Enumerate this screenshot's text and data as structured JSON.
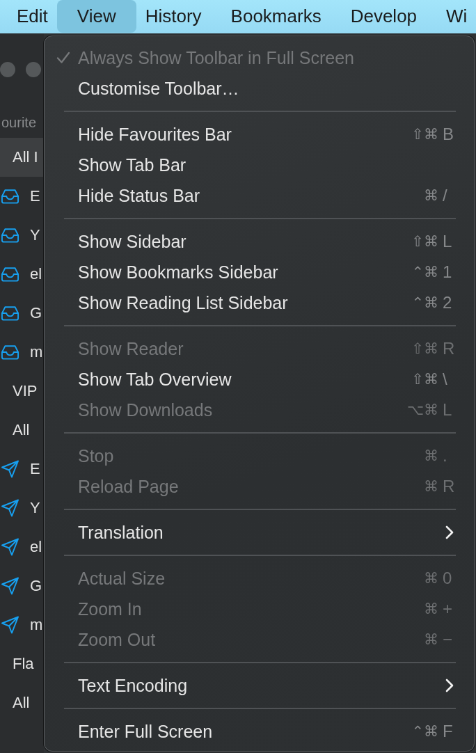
{
  "menu_bar": [
    {
      "label": "Edit",
      "selected": false
    },
    {
      "label": "View",
      "selected": true
    },
    {
      "label": "History",
      "selected": false
    },
    {
      "label": "Bookmarks",
      "selected": false
    },
    {
      "label": "Develop",
      "selected": false
    },
    {
      "label": "Wi",
      "selected": false
    }
  ],
  "sidebar": {
    "section_title": "ourite",
    "items": [
      {
        "label": "All I",
        "selected": true,
        "children": [
          {
            "label": "E",
            "kind": "inbox",
            "selected": false
          },
          {
            "label": "Y",
            "kind": "inbox",
            "selected": false
          },
          {
            "label": "el",
            "kind": "inbox",
            "selected": false
          },
          {
            "label": "G",
            "kind": "inbox",
            "selected": false
          },
          {
            "label": "m",
            "kind": "inbox",
            "selected": false
          }
        ]
      },
      {
        "label": "VIP",
        "selected": false
      },
      {
        "label": "All",
        "selected": false,
        "children": [
          {
            "label": "E",
            "kind": "sent",
            "selected": false
          },
          {
            "label": "Y",
            "kind": "sent",
            "selected": false
          },
          {
            "label": "el",
            "kind": "sent",
            "selected": false
          },
          {
            "label": "G",
            "kind": "sent",
            "selected": false
          },
          {
            "label": "m",
            "kind": "sent",
            "selected": false
          }
        ]
      },
      {
        "label": "Fla",
        "selected": false
      },
      {
        "label": "All",
        "selected": false
      }
    ]
  },
  "view_menu": {
    "groups": [
      {
        "items": [
          {
            "label": "Always Show Toolbar in Full Screen",
            "checked": true,
            "disabled": true,
            "submenu": false
          },
          {
            "label": "Customise Toolbar…",
            "checked": false,
            "disabled": false,
            "submenu": false
          }
        ]
      },
      {
        "items": [
          {
            "label": "Hide Favourites Bar",
            "checked": false,
            "disabled": false,
            "submenu": false,
            "shortcut": {
              "modifiers": "⇧⌘",
              "key": "B"
            }
          },
          {
            "label": "Show Tab Bar",
            "checked": false,
            "disabled": false,
            "submenu": false
          },
          {
            "label": "Hide Status Bar",
            "checked": false,
            "disabled": false,
            "submenu": false,
            "shortcut": {
              "modifiers": "⌘",
              "key": "/"
            }
          }
        ]
      },
      {
        "items": [
          {
            "label": "Show Sidebar",
            "checked": false,
            "disabled": false,
            "submenu": false,
            "shortcut": {
              "modifiers": "⇧⌘",
              "key": "L"
            }
          },
          {
            "label": "Show Bookmarks Sidebar",
            "checked": false,
            "disabled": false,
            "submenu": false,
            "shortcut": {
              "modifiers": "⌃⌘",
              "key": "1"
            }
          },
          {
            "label": "Show Reading List Sidebar",
            "checked": false,
            "disabled": false,
            "submenu": false,
            "shortcut": {
              "modifiers": "⌃⌘",
              "key": "2"
            }
          }
        ]
      },
      {
        "items": [
          {
            "label": "Show Reader",
            "checked": false,
            "disabled": true,
            "submenu": false,
            "shortcut": {
              "modifiers": "⇧⌘",
              "key": "R"
            }
          },
          {
            "label": "Show Tab Overview",
            "checked": false,
            "disabled": false,
            "submenu": false,
            "shortcut": {
              "modifiers": "⇧⌘",
              "key": "\\"
            }
          },
          {
            "label": "Show Downloads",
            "checked": false,
            "disabled": true,
            "submenu": false,
            "shortcut": {
              "modifiers": "⌥⌘",
              "key": "L"
            }
          }
        ]
      },
      {
        "items": [
          {
            "label": "Stop",
            "checked": false,
            "disabled": true,
            "submenu": false,
            "shortcut": {
              "modifiers": "⌘",
              "key": "."
            }
          },
          {
            "label": "Reload Page",
            "checked": false,
            "disabled": true,
            "submenu": false,
            "shortcut": {
              "modifiers": "⌘",
              "key": "R"
            }
          }
        ]
      },
      {
        "items": [
          {
            "label": "Translation",
            "checked": false,
            "disabled": false,
            "submenu": true
          }
        ]
      },
      {
        "items": [
          {
            "label": "Actual Size",
            "checked": false,
            "disabled": true,
            "submenu": false,
            "shortcut": {
              "modifiers": "⌘",
              "key": "0"
            }
          },
          {
            "label": "Zoom In",
            "checked": false,
            "disabled": true,
            "submenu": false,
            "shortcut": {
              "modifiers": "⌘",
              "key": "+"
            }
          },
          {
            "label": "Zoom Out",
            "checked": false,
            "disabled": true,
            "submenu": false,
            "shortcut": {
              "modifiers": "⌘",
              "key": "−"
            }
          }
        ]
      },
      {
        "items": [
          {
            "label": "Text Encoding",
            "checked": false,
            "disabled": false,
            "submenu": true
          }
        ]
      },
      {
        "items": [
          {
            "label": "Enter Full Screen",
            "checked": false,
            "disabled": false,
            "submenu": false,
            "shortcut": {
              "modifiers": "⌃⌘",
              "key": "F"
            }
          }
        ]
      }
    ]
  }
}
